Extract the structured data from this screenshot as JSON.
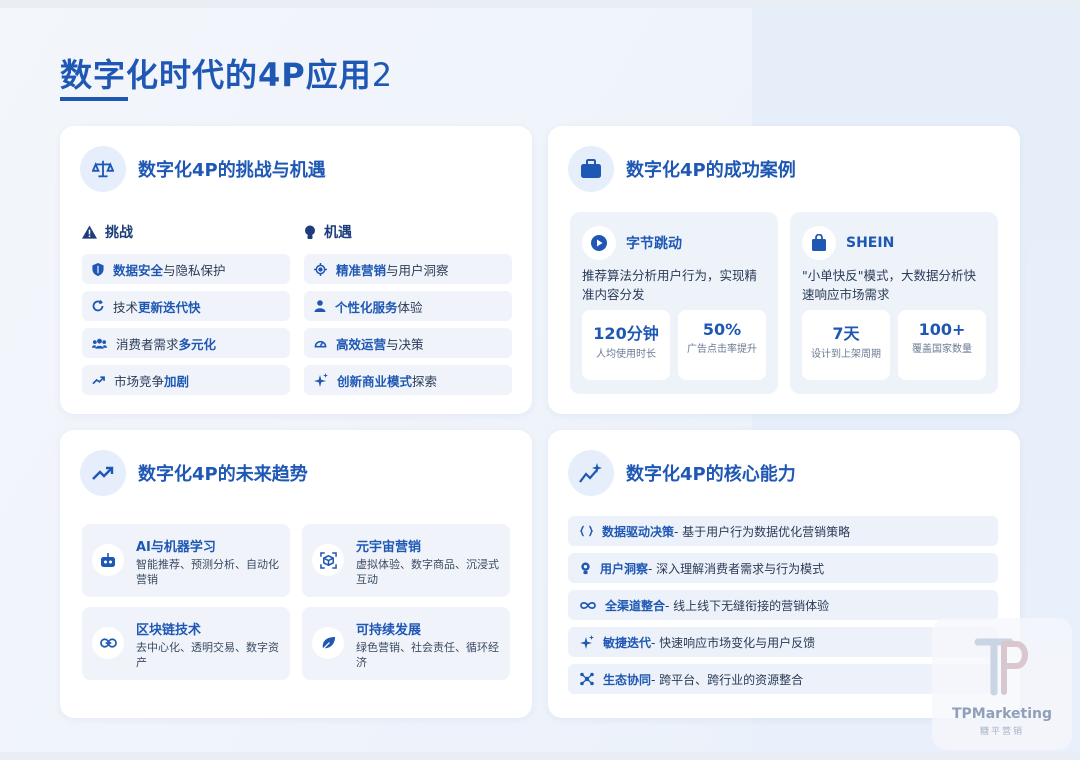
{
  "title": {
    "main": "数字化时代的4P应用",
    "num": "2"
  },
  "challenges_card": {
    "title": "数字化4P的挑战与机遇",
    "challenges_label": "挑战",
    "opportunities_label": "机遇",
    "challenges": [
      {
        "icon": "shield-icon",
        "hl": "数据安全",
        "rest": "与隐私保护",
        "pre": ""
      },
      {
        "icon": "refresh-icon",
        "pre": "技术",
        "hl": "更新迭代快",
        "rest": ""
      },
      {
        "icon": "users-icon",
        "pre": "消费者需求",
        "hl": "多元化",
        "rest": ""
      },
      {
        "icon": "trend-icon",
        "pre": "市场竞争",
        "hl": "加剧",
        "rest": ""
      }
    ],
    "opportunities": [
      {
        "icon": "target-icon",
        "pre": "",
        "hl": "精准营销",
        "rest": "与用户洞察"
      },
      {
        "icon": "user-icon",
        "pre": "",
        "hl": "个性化服务",
        "rest": "体验"
      },
      {
        "icon": "gauge-icon",
        "pre": "",
        "hl": "高效运营",
        "rest": "与决策"
      },
      {
        "icon": "sparkle-icon",
        "pre": "",
        "hl": "创新商业模式",
        "rest": "探索"
      }
    ]
  },
  "cases_card": {
    "title": "数字化4P的成功案例",
    "cases": [
      {
        "name": "字节跳动",
        "desc": "推荐算法分析用户行为，实现精准内容分发",
        "stats": [
          {
            "value": "120分钟",
            "label": "人均使用时长"
          },
          {
            "value": "50%",
            "label": "广告点击率提升"
          }
        ]
      },
      {
        "name": "SHEIN",
        "desc": "\"小单快反\"模式，大数据分析快速响应市场需求",
        "stats": [
          {
            "value": "7天",
            "label": "设计到上架周期"
          },
          {
            "value": "100+",
            "label": "覆盖国家数量"
          }
        ]
      }
    ]
  },
  "trends_card": {
    "title": "数字化4P的未来趋势",
    "items": [
      {
        "name": "AI与机器学习",
        "desc": "智能推荐、预测分析、自动化营销",
        "icon": "robot-icon"
      },
      {
        "name": "元宇宙营销",
        "desc": "虚拟体验、数字商品、沉浸式互动",
        "icon": "cube-icon"
      },
      {
        "name": "区块链技术",
        "desc": "去中心化、透明交易、数字资产",
        "icon": "link-icon"
      },
      {
        "name": "可持续发展",
        "desc": "绿色营销、社会责任、循环经济",
        "icon": "leaf-icon"
      }
    ]
  },
  "core_card": {
    "title": "数字化4P的核心能力",
    "items": [
      {
        "name": "数据驱动决策",
        "desc": " - 基于用户行为数据优化营销策略",
        "icon": "braces-icon"
      },
      {
        "name": "用户洞察",
        "desc": " - 深入理解消费者需求与行为模式",
        "icon": "bulb-icon"
      },
      {
        "name": "全渠道整合",
        "desc": " - 线上线下无缝衔接的营销体验",
        "icon": "infinity-icon"
      },
      {
        "name": "敏捷迭代",
        "desc": " - 快速响应市场变化与用户反馈",
        "icon": "sparkle-icon"
      },
      {
        "name": "生态协同",
        "desc": " - 跨平台、跨行业的资源整合",
        "icon": "network-icon"
      }
    ]
  },
  "watermark": {
    "text": "TPMarketing",
    "sub": "糖平营销"
  },
  "colors": {
    "primary": "#1f58b4",
    "pill_bg": "#f0f4fa"
  }
}
